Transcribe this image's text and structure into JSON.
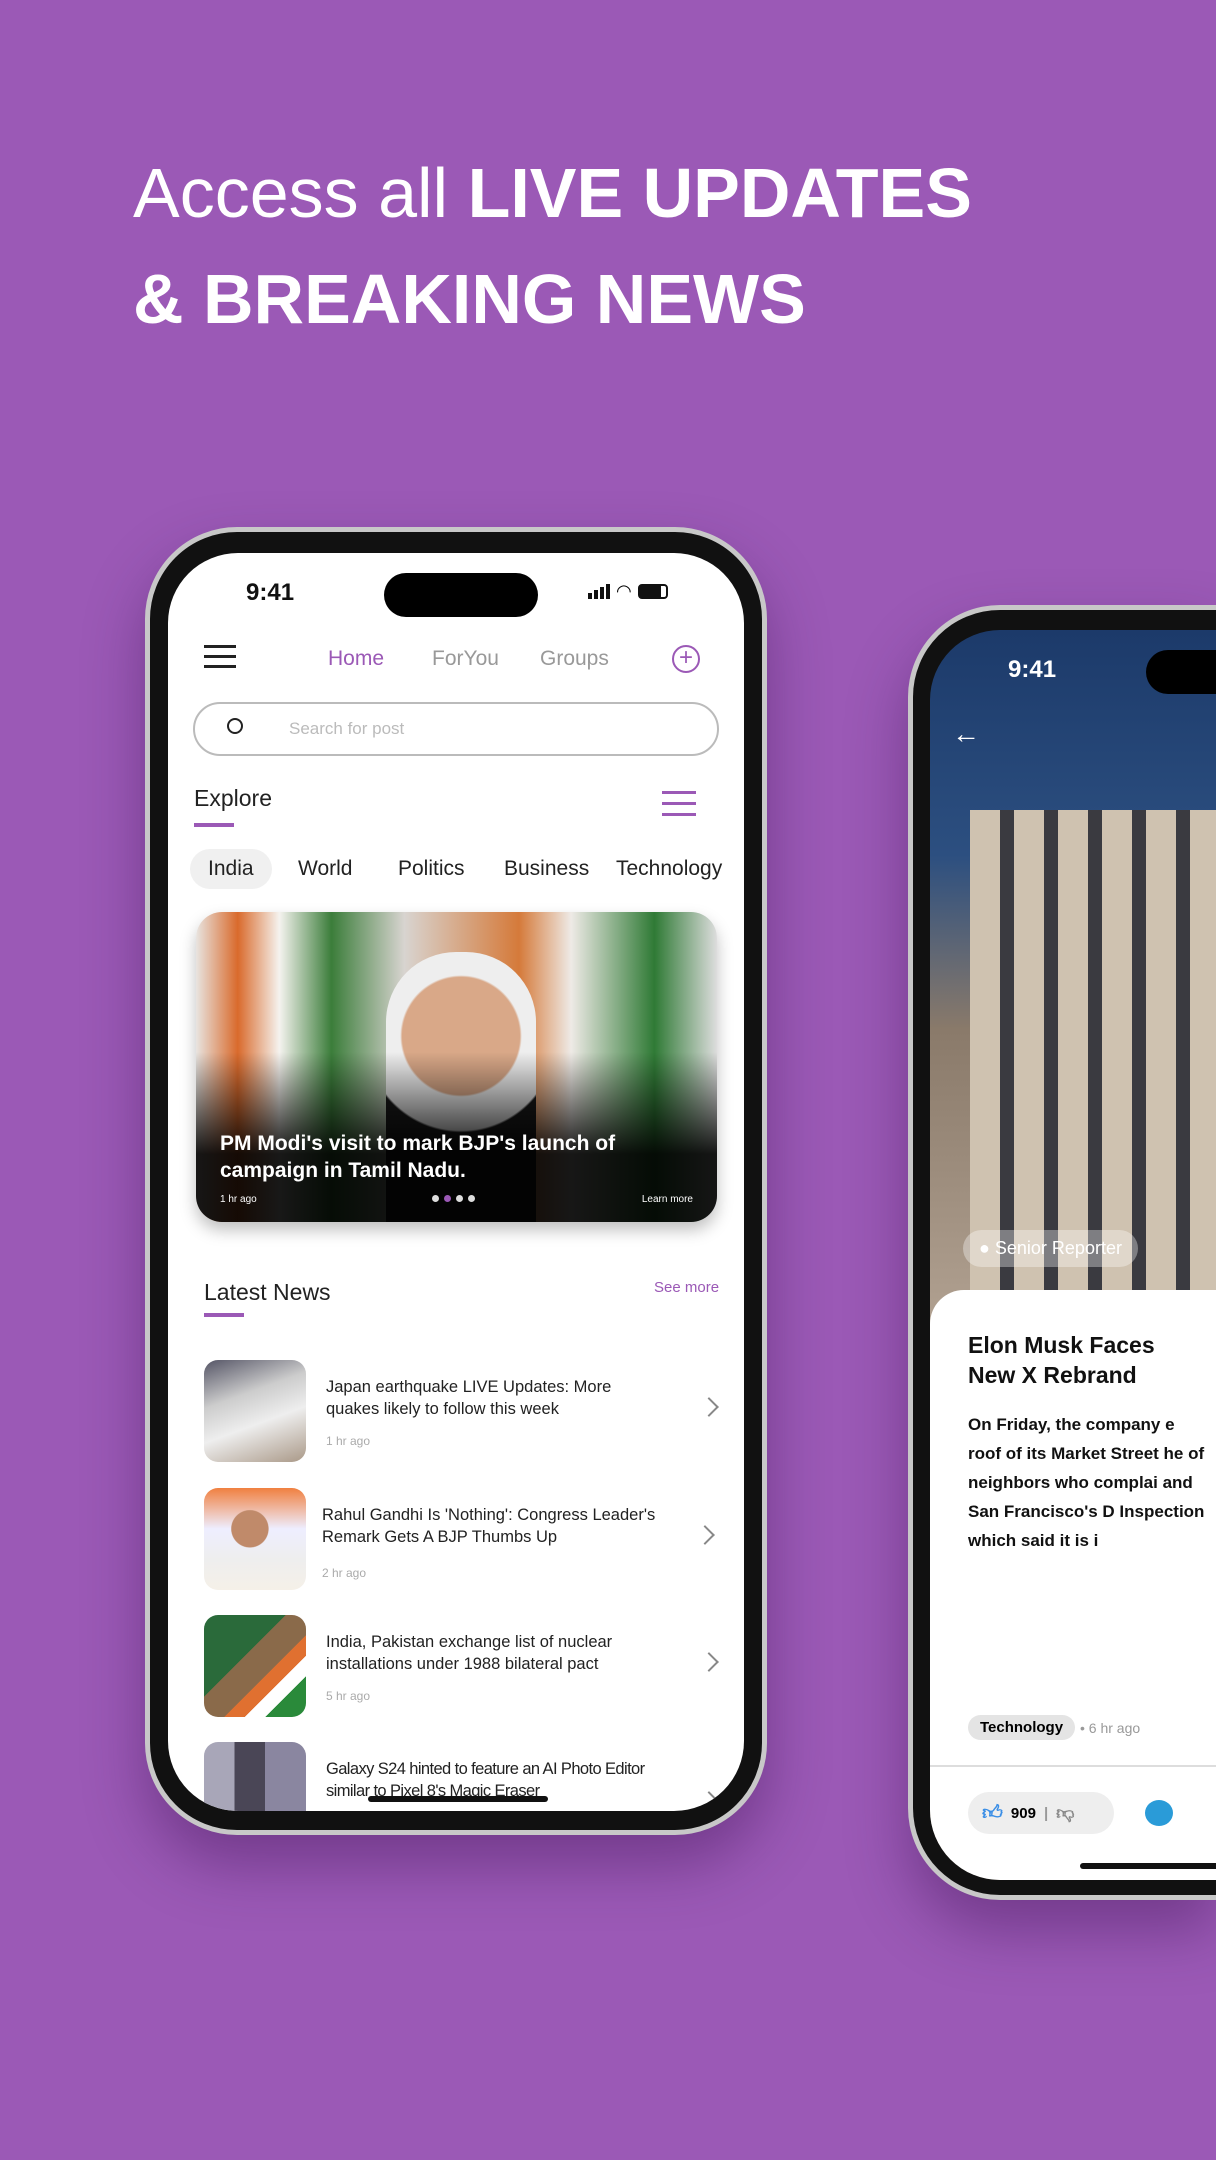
{
  "headline": {
    "line1_light": "Access all ",
    "line1_bold": "LIVE UPDATES",
    "line2": "& BREAKING NEWS"
  },
  "colors": {
    "background": "#9b59b6",
    "accent": "#9b59b6"
  },
  "phone1": {
    "status_time": "9:41",
    "nav": {
      "tabs": [
        "Home",
        "ForYou",
        "Groups"
      ],
      "active": "Home"
    },
    "search": {
      "placeholder": "Search for post"
    },
    "explore": {
      "title": "Explore"
    },
    "categories": [
      "India",
      "World",
      "Politics",
      "Business",
      "Technology"
    ],
    "active_category": "India",
    "featured": {
      "title": "PM Modi's visit to mark BJP's launch of campaign in Tamil Nadu.",
      "time": "1 hr ago",
      "learn_more": "Learn more",
      "carousel_count": 4,
      "carousel_active": 2
    },
    "latest": {
      "title": "Latest News",
      "see_more": "See more",
      "items": [
        {
          "title": "Japan earthquake LIVE Updates: More quakes likely to follow this week",
          "time": "1 hr ago"
        },
        {
          "title": "Rahul Gandhi Is 'Nothing': Congress Leader's Remark Gets A BJP Thumbs Up",
          "time": "2 hr ago"
        },
        {
          "title": "India, Pakistan exchange list of nuclear installations under 1988 bilateral pact",
          "time": "5 hr ago"
        },
        {
          "title": "Galaxy S24 hinted to feature an AI Photo Editor similar to Pixel 8's Magic Eraser",
          "time": ""
        }
      ]
    }
  },
  "phone2": {
    "status_time": "9:41",
    "author_badge": "Senior Reporter",
    "article": {
      "title": "Elon Musk Faces New X Rebrand",
      "body": "On Friday, the company e roof of its Market Street he of neighbors who complai and San Francisco's D Inspection which said it is i",
      "tag": "Technology",
      "time": "6 hr ago"
    },
    "likes": "909"
  }
}
